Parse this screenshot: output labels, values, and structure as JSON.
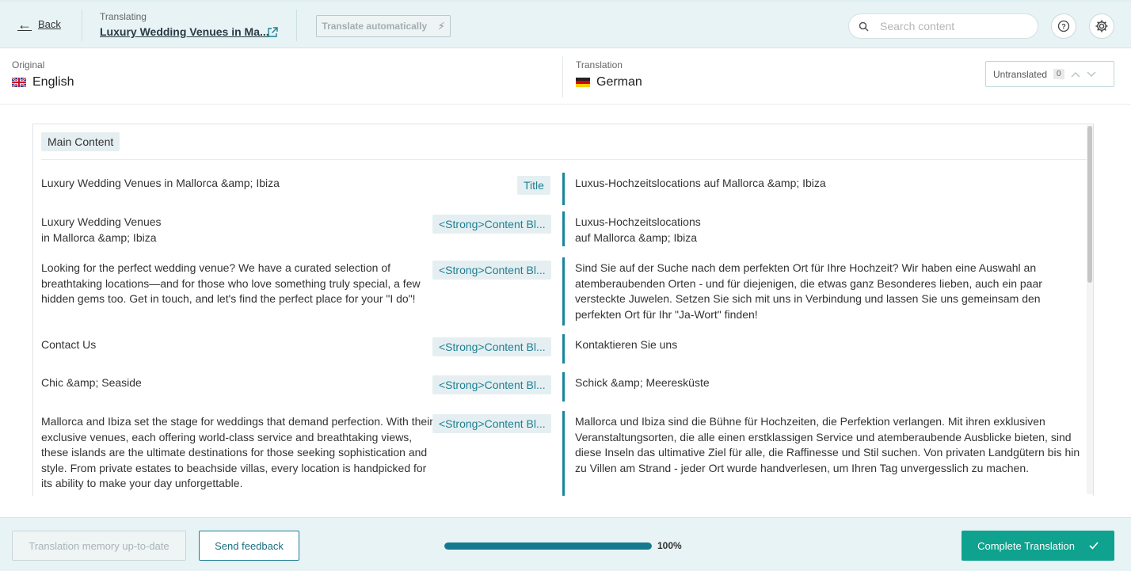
{
  "header": {
    "back_label": "Back",
    "translating_label": "Translating",
    "page_title": "Luxury Wedding Venues in Ma...",
    "auto_translate_label": "Translate automatically",
    "search_placeholder": "Search content"
  },
  "languages": {
    "original_label": "Original",
    "original_name": "English",
    "translation_label": "Translation",
    "translation_name": "German",
    "untranslated_label": "Untranslated",
    "untranslated_count": "0"
  },
  "section": {
    "label": "Main Content"
  },
  "rows": [
    {
      "original": "Luxury Wedding Venues in Mallorca &amp; Ibiza",
      "tag": "Title",
      "translation": "Luxus-Hochzeitslocations auf Mallorca &amp; Ibiza"
    },
    {
      "original": "Luxury Wedding Venues\nin Mallorca &amp; Ibiza",
      "tag": "<Strong>Content Bl...",
      "translation": "Luxus-Hochzeitslocations\nauf Mallorca &amp; Ibiza"
    },
    {
      "original": "Looking for the perfect wedding venue? We have a curated selection of breathtaking locations—and for those who love something truly special, a few hidden gems too. Get in touch, and let's find the perfect place for your \"I do\"!",
      "tag": "<Strong>Content Bl...",
      "translation": "Sind Sie auf der Suche nach dem perfekten Ort für Ihre Hochzeit? Wir haben eine Auswahl an atemberaubenden Orten - und für diejenigen, die etwas ganz Besonderes lieben, auch ein paar versteckte Juwelen. Setzen Sie sich mit uns in Verbindung und lassen Sie uns gemeinsam den perfekten Ort für Ihr \"Ja-Wort\" finden!"
    },
    {
      "original": "Contact Us",
      "tag": "<Strong>Content Bl...",
      "translation": "Kontaktieren Sie uns"
    },
    {
      "original": "Chic &amp; Seaside",
      "tag": "<Strong>Content Bl...",
      "translation": "Schick &amp; Meeresküste"
    },
    {
      "original": "Mallorca and Ibiza set the stage for weddings that demand perfection. With their exclusive venues, each offering world-class service and breathtaking views, these islands are the ultimate destinations for those seeking sophistication and style. From private estates to beachside villas, every location is handpicked for its ability to make your day unforgettable.",
      "tag": "<Strong>Content Bl...",
      "translation": "Mallorca und Ibiza sind die Bühne für Hochzeiten, die Perfektion verlangen. Mit ihren exklusiven Veranstaltungsorten, die alle einen erstklassigen Service und atemberaubende Ausblicke bieten, sind diese Inseln das ultimative Ziel für alle, die Raffinesse und Stil suchen. Von privaten Landgütern bis hin zu Villen am Strand - jeder Ort wurde handverlesen, um Ihren Tag unvergesslich zu machen."
    }
  ],
  "footer": {
    "memory_label": "Translation memory up-to-date",
    "feedback_label": "Send feedback",
    "progress": 1.0,
    "progress_text": "100%",
    "complete_label": "Complete Translation"
  },
  "colors": {
    "accent": "#17869b",
    "complete_button": "#0fa28e",
    "header_bg": "#e8f3f5"
  }
}
